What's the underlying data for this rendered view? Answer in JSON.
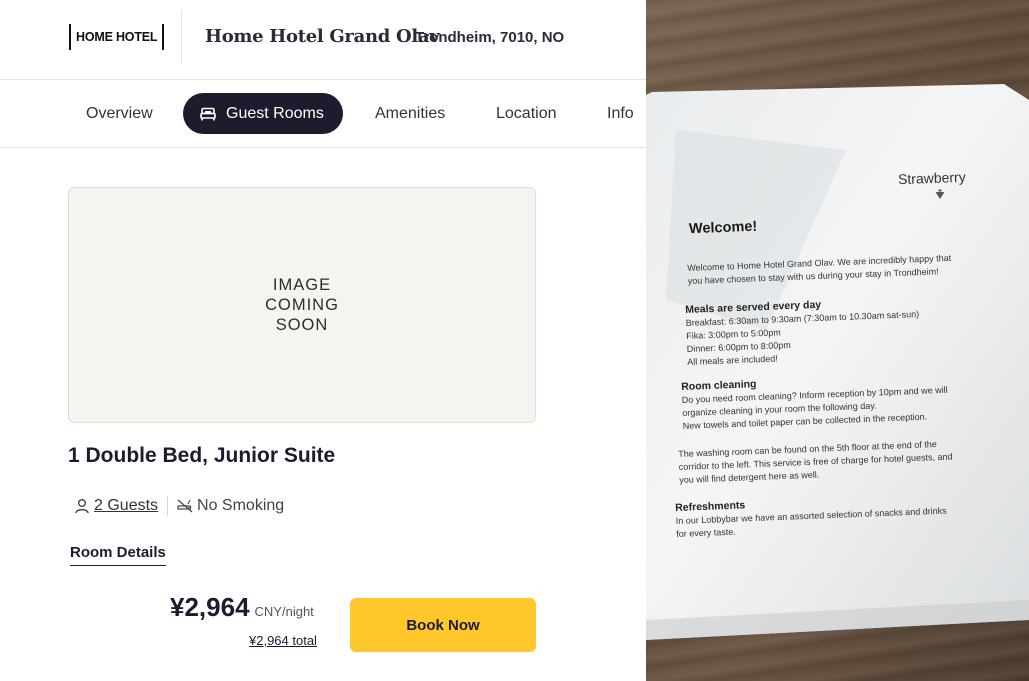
{
  "header": {
    "logo_text": "HOME HOTEL",
    "hotel_name": "Home Hotel Grand Olav",
    "location": "Trondheim, 7010, NO"
  },
  "tabs": [
    {
      "label": "Overview",
      "active": false
    },
    {
      "label": "Guest Rooms",
      "active": true,
      "icon": "bed-icon"
    },
    {
      "label": "Amenities",
      "active": false
    },
    {
      "label": "Location",
      "active": false
    },
    {
      "label": "Info",
      "active": false
    }
  ],
  "room": {
    "image_placeholder": "IMAGE COMING SOON",
    "title": "1 Double Bed, Junior Suite",
    "guests": "2 Guests",
    "smoking": "No Smoking",
    "details_link": "Room Details",
    "price": "¥2,964",
    "price_unit": "CNY/night",
    "total": "¥2,964 total",
    "book_label": "Book Now"
  },
  "photo": {
    "brand": "Strawberry",
    "welcome": "Welcome!",
    "intro": [
      "Welcome to Home Hotel Grand Olav. We are incredibly happy that",
      "you have chosen to stay with us during your stay in Trondheim!"
    ],
    "meals_title": "Meals are served every day",
    "meals": [
      "Breakfast: 6:30am to 9:30am (7:30am to 10.30am sat-sun)",
      "Fika: 3:00pm to 5:00pm",
      "Dinner: 6:00pm to 8:00pm",
      "All meals are included!"
    ],
    "cleaning_title": "Room cleaning",
    "cleaning": [
      "Do you need room cleaning? Inform reception by 10pm and we will",
      "organize cleaning in your room the following day.",
      "New towels and toilet paper can be collected in the reception."
    ],
    "washing": [
      "The washing room can be found on the 5th floor at the end of the",
      "corridor to the left. This service is free of charge for hotel guests, and",
      "you will find detergent here as well."
    ],
    "refresh_title": "Refreshments",
    "refresh": [
      "In our Lobbybar we have an assorted selection of snacks and drinks",
      "for every taste."
    ]
  },
  "colors": {
    "accent_dark": "#1c1c2e",
    "book_button": "#ffc72c"
  }
}
